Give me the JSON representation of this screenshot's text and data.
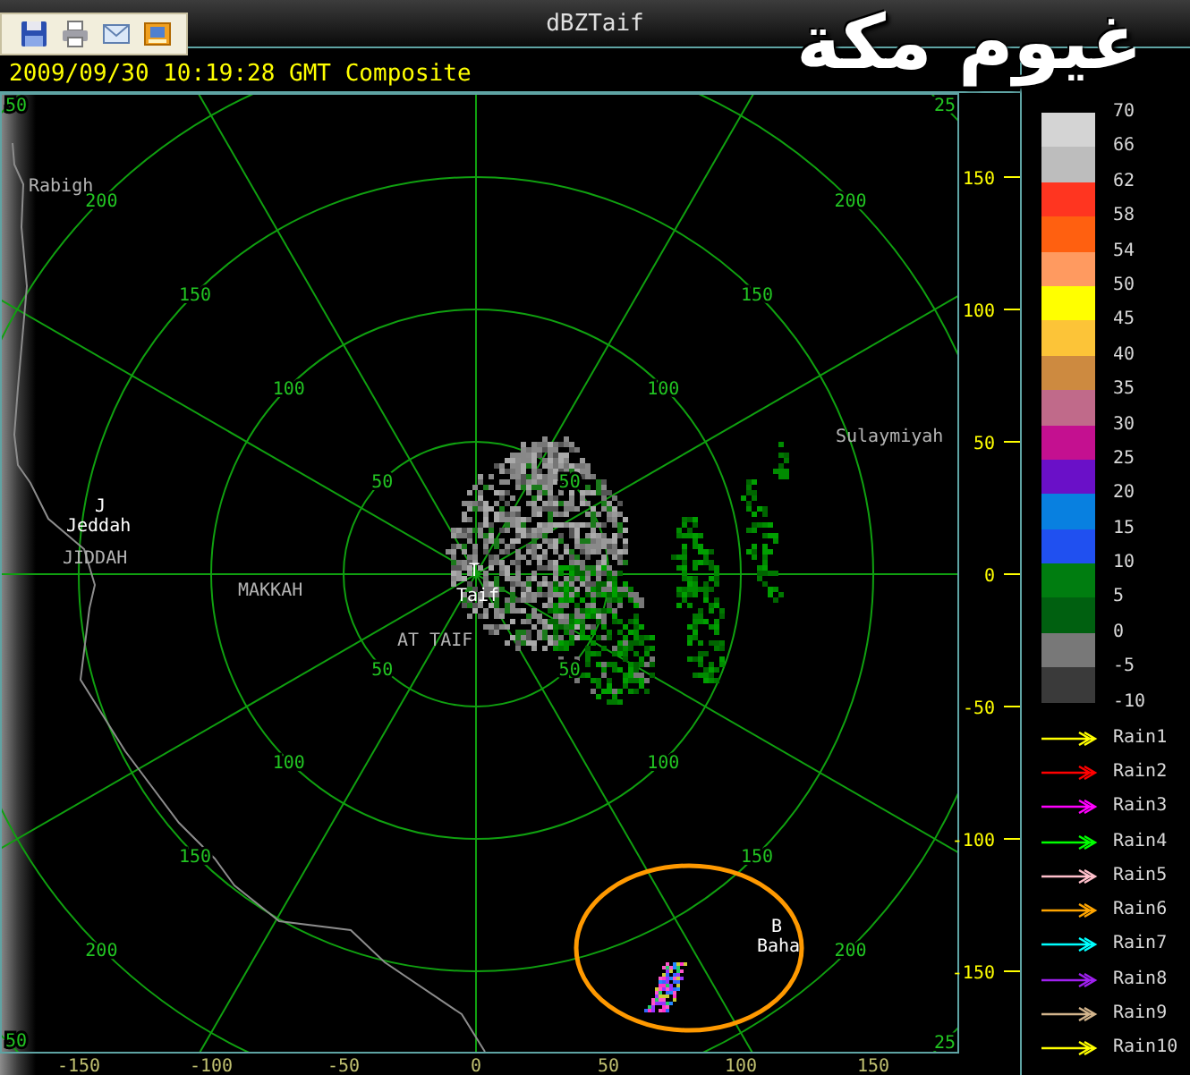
{
  "window": {
    "title": "dBZTaif"
  },
  "toolbar": [
    {
      "kind": "save"
    },
    {
      "kind": "print"
    },
    {
      "kind": "mail"
    },
    {
      "kind": "frame"
    }
  ],
  "overlay_caption": "غيوم مكة",
  "timestamp": "2009/09/30 10:19:28 GMT Composite",
  "map": {
    "places": [
      {
        "kind": "region",
        "text": "Rabigh"
      },
      {
        "kind": "marker",
        "text": "J"
      },
      {
        "kind": "city",
        "text": "Jeddah"
      },
      {
        "kind": "region",
        "text": "JIDDAH"
      },
      {
        "kind": "region",
        "text": "MAKKAH"
      },
      {
        "kind": "marker",
        "text": "T"
      },
      {
        "kind": "city",
        "text": "Taif"
      },
      {
        "kind": "region",
        "text": "AT TAIF"
      },
      {
        "kind": "region",
        "text": "Sulaymiyah"
      },
      {
        "kind": "marker",
        "text": "B"
      },
      {
        "kind": "city",
        "text": "Baha"
      }
    ],
    "range_labels": [
      "50",
      "25",
      "200",
      "200",
      "150",
      "150",
      "100",
      "100",
      "50",
      "50",
      "50",
      "50",
      "100",
      "100",
      "150",
      "150",
      "200",
      "200",
      "50",
      "25"
    ],
    "y_ticks": [
      "150",
      "100",
      "50",
      "0",
      "-50",
      "-100",
      "-150"
    ],
    "x_ticks": [
      "-150",
      "-100",
      "-50",
      "0",
      "50",
      "100",
      "150"
    ]
  },
  "legend": [
    {
      "label": "70",
      "color": "#d4d4d4"
    },
    {
      "label": "66",
      "color": "#bdbdbd"
    },
    {
      "label": "62",
      "color": "#ff3520"
    },
    {
      "label": "58",
      "color": "#ff6010"
    },
    {
      "label": "54",
      "color": "#ff9a60"
    },
    {
      "label": "50",
      "color": "#ffff00"
    },
    {
      "label": "45",
      "color": "#fcc438"
    },
    {
      "label": "40",
      "color": "#cd8a40"
    },
    {
      "label": "35",
      "color": "#c06a8a"
    },
    {
      "label": "30",
      "color": "#c41090"
    },
    {
      "label": "25",
      "color": "#6a10c8"
    },
    {
      "label": "20",
      "color": "#0880e0"
    },
    {
      "label": "15",
      "color": "#2050f0"
    },
    {
      "label": "10",
      "color": "#007d10"
    },
    {
      "label": "5",
      "color": "#006010"
    },
    {
      "label": "0",
      "color": "#787878"
    },
    {
      "label": "-5",
      "color": "#3a3a3a"
    },
    {
      "label": "-10"
    }
  ],
  "rain_legend": [
    {
      "label": "Rain1",
      "color": "#ffff00"
    },
    {
      "label": "Rain2",
      "color": "#ff0000"
    },
    {
      "label": "Rain3",
      "color": "#ff00ff"
    },
    {
      "label": "Rain4",
      "color": "#00ff00"
    },
    {
      "label": "Rain5",
      "color": "#ffc0cb"
    },
    {
      "label": "Rain6",
      "color": "#ffa500"
    },
    {
      "label": "Rain7",
      "color": "#00ffff"
    },
    {
      "label": "Rain8",
      "color": "#a020f0"
    },
    {
      "label": "Rain9",
      "color": "#d2b48c"
    },
    {
      "label": "Rain10",
      "color": "#ffff00"
    }
  ]
}
